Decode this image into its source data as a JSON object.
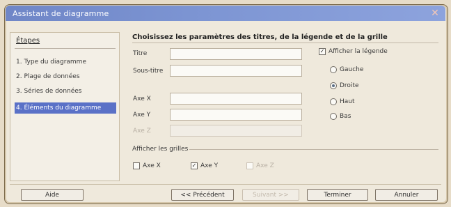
{
  "window": {
    "title": "Assistant de diagramme",
    "close_glyph": "✕"
  },
  "steps": {
    "title": "Étapes",
    "items": [
      {
        "label": "1. Type du diagramme"
      },
      {
        "label": "2. Plage de données"
      },
      {
        "label": "3. Séries de données"
      },
      {
        "label": "4. Éléments du diagramme"
      }
    ]
  },
  "main": {
    "header": "Choisissez les paramètres des titres, de la légende et de la grille",
    "fields": {
      "titre": {
        "label": "Titre",
        "value": ""
      },
      "sous_titre": {
        "label": "Sous-titre",
        "value": ""
      },
      "axe_x": {
        "label": "Axe X",
        "value": ""
      },
      "axe_y": {
        "label": "Axe Y",
        "value": ""
      },
      "axe_z": {
        "label": "Axe Z",
        "value": ""
      }
    },
    "legend": {
      "label": "Afficher la légende",
      "checked": "✓",
      "options": [
        {
          "label": "Gauche"
        },
        {
          "label": "Droite"
        },
        {
          "label": "Haut"
        },
        {
          "label": "Bas"
        }
      ]
    },
    "grid": {
      "label": "Afficher les grilles",
      "options": [
        {
          "label": "Axe X"
        },
        {
          "label": "Axe Y",
          "checked": "✓"
        },
        {
          "label": "Axe Z"
        }
      ]
    }
  },
  "buttons": {
    "aide": "Aide",
    "precedent": "<< Précédent",
    "suivant": "Suivant >>",
    "terminer": "Terminer",
    "annuler": "Annuler"
  },
  "colors": {
    "titlebar": "#7d95d3",
    "selected_step": "#5a71c7",
    "background": "#efe9dc"
  }
}
